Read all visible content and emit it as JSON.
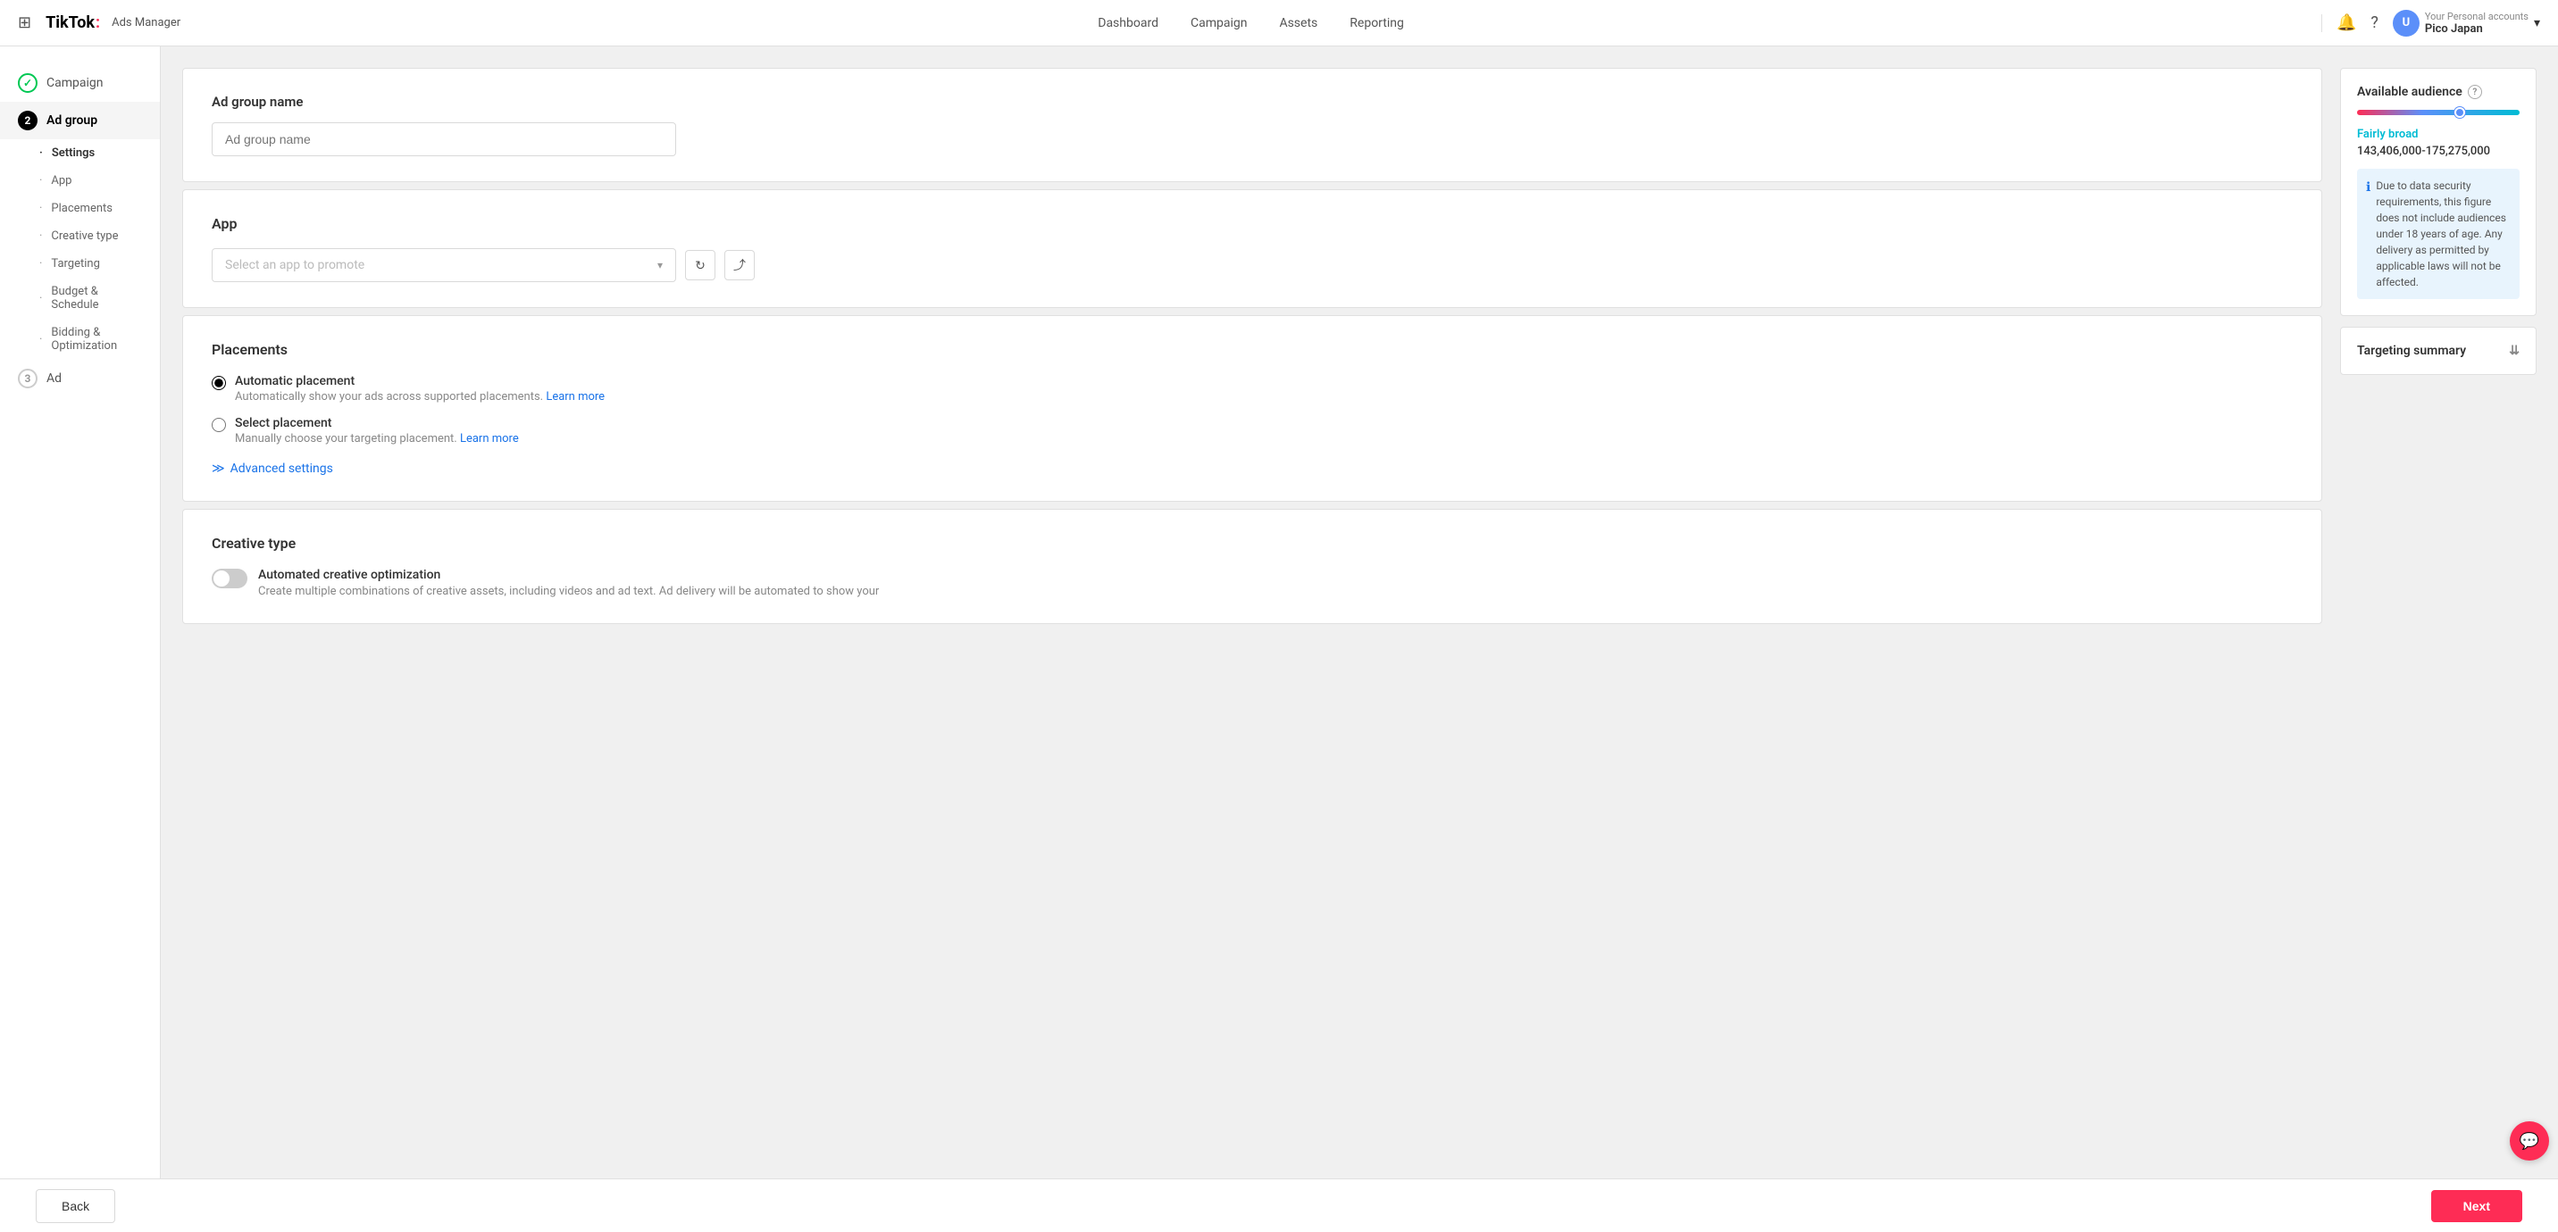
{
  "topnav": {
    "grid_icon": "⊞",
    "logo": "TikTok",
    "logo_dot": ":",
    "ads_manager": "Ads Manager",
    "nav_links": [
      "Dashboard",
      "Campaign",
      "Assets",
      "Reporting"
    ],
    "user_initial": "U",
    "user_account_label": "Your Personal accounts",
    "user_account_name": "Pico Japan",
    "chevron": "▾"
  },
  "sidebar": {
    "step1": {
      "label": "Campaign",
      "status": "done",
      "step_num": "✓"
    },
    "step2": {
      "label": "Ad group",
      "status": "active",
      "step_num": "2"
    },
    "step2_sub": {
      "settings": "Settings",
      "app": "App",
      "placements": "Placements",
      "creative_type": "Creative type",
      "targeting": "Targeting",
      "budget_schedule": "Budget & Schedule",
      "bidding_optimization": "Bidding & Optimization"
    },
    "step3": {
      "label": "Ad",
      "status": "inactive",
      "step_num": "3"
    }
  },
  "ad_group_name_section": {
    "label": "Ad group name",
    "placeholder": "Ad group name"
  },
  "app_section": {
    "title": "App",
    "select_placeholder": "Select an app to promote",
    "refresh_icon": "↻",
    "external_icon": "⤴"
  },
  "placements_section": {
    "title": "Placements",
    "automatic": {
      "label": "Automatic placement",
      "desc_text": "Automatically show your ads across supported placements.",
      "learn_more": "Learn more",
      "selected": true
    },
    "select": {
      "label": "Select placement",
      "desc_text": "Manually choose your targeting placement.",
      "learn_more": "Learn more",
      "selected": false
    },
    "advanced_settings": "Advanced settings",
    "advanced_icon": "≫"
  },
  "creative_type_section": {
    "title": "Creative type",
    "toggle_label": "Automated creative optimization",
    "toggle_desc": "Create multiple combinations of creative assets, including videos and ad text. Ad delivery will be automated to show your",
    "toggle_on": false
  },
  "right_panel": {
    "audience": {
      "title": "Available audience",
      "help": "?",
      "label": "Fairly broad",
      "range": "143,406,000-175,275,000",
      "info_text": "Due to data security requirements, this figure does not include audiences under 18 years of age. Any delivery as permitted by applicable laws will not be affected."
    },
    "targeting_summary": {
      "title": "Targeting summary",
      "chevron": "⇊"
    }
  },
  "bottom_bar": {
    "back_label": "Back",
    "next_label": "Next"
  }
}
